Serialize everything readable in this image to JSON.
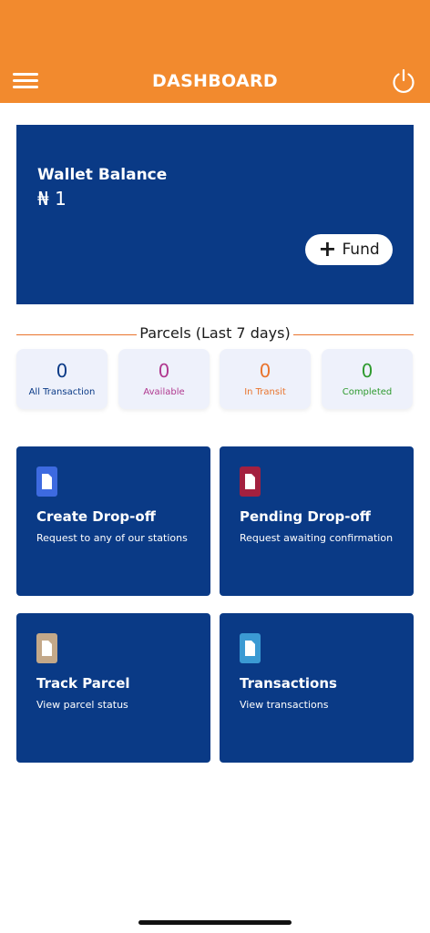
{
  "header": {
    "title": "DASHBOARD",
    "menu_icon": "hamburger-menu-icon",
    "power_icon": "power-icon",
    "background": "#f28a2e"
  },
  "wallet": {
    "label": "Wallet Balance",
    "amount": "₦ 1",
    "fund_label": "Fund",
    "fund_icon": "plus-icon",
    "background": "#0a3a86"
  },
  "parcels": {
    "title": "Parcels (Last 7 days)",
    "stats": [
      {
        "value": "0",
        "label": "All Transaction",
        "color": "#0a3a86"
      },
      {
        "value": "0",
        "label": "Available",
        "color": "#b0388f"
      },
      {
        "value": "0",
        "label": "In Transit",
        "color": "#e9742d"
      },
      {
        "value": "0",
        "label": "Completed",
        "color": "#2e9a2e"
      }
    ]
  },
  "tiles": [
    {
      "title": "Create Drop-off",
      "subtitle": "Request to any of our stations",
      "icon": "document-icon",
      "icon_color": "#3d6ae0"
    },
    {
      "title": "Pending Drop-off",
      "subtitle": "Request awaiting confirmation",
      "icon": "document-icon",
      "icon_color": "#a3203f"
    },
    {
      "title": "Track Parcel",
      "subtitle": "View parcel status",
      "icon": "document-icon",
      "icon_color": "#c3a889"
    },
    {
      "title": "Transactions",
      "subtitle": "View transactions",
      "icon": "document-icon",
      "icon_color": "#3b9ad3"
    }
  ]
}
